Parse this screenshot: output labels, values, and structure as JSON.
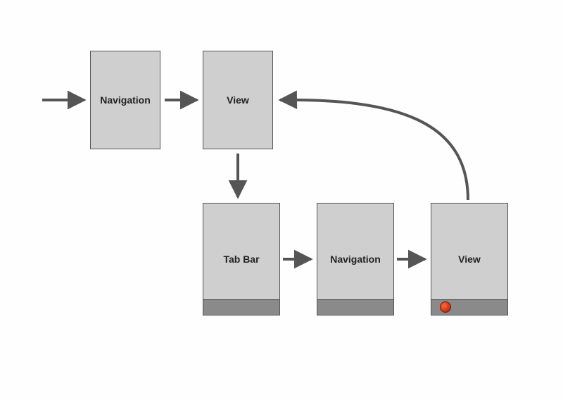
{
  "nodes": {
    "nav1": {
      "label": "Navigation"
    },
    "view1": {
      "label": "View"
    },
    "tabbar": {
      "label": "Tab Bar"
    },
    "nav2": {
      "label": "Navigation"
    },
    "view2": {
      "label": "View"
    }
  },
  "edges": [
    {
      "id": "in-nav1",
      "from": "external",
      "to": "nav1"
    },
    {
      "id": "nav1-view1",
      "from": "nav1",
      "to": "view1"
    },
    {
      "id": "view1-tabbar",
      "from": "view1",
      "to": "tabbar"
    },
    {
      "id": "tabbar-nav2",
      "from": "tabbar",
      "to": "nav2"
    },
    {
      "id": "nav2-view2",
      "from": "nav2",
      "to": "view2"
    },
    {
      "id": "view2-view1",
      "from": "view2",
      "to": "view1"
    }
  ],
  "flags": {
    "view2_has_indicator": true
  }
}
